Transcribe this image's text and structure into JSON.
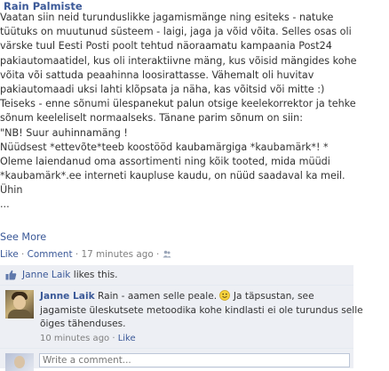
{
  "post": {
    "author": "Rain Palmiste",
    "lines": [
      "Vaatan siin neid turunduslikke jagamismänge ning esiteks - natuke",
      "tüütuks on muutunud süsteem - laigi, jaga ja võid võita. Selles osas oli",
      "värske tuul Eesti Posti poolt tehtud näoraamatu kampaania Post24",
      "pakiautomaatidel, kus oli interaktiivne mäng, kus võisid mängides kohe",
      "võita või sattuda peaahinna loosirattasse. Vähemalt oli huvitav",
      "pakiautomaadi uksi lahti klõpsata ja näha, kas võitsid või mitte :)",
      "Teiseks - enne sõnumi ülespanekut palun otsige keelekorrektor ja tehke",
      "sõnum keeleliselt normaalseks. Tänane parim sõnum on siin:",
      "\"NB! Suur auhinnamäng !",
      "Nüüdsest *ettevõte*teeb koostööd kaubamärgiga *kaubamärk*! *",
      "Oleme laiendanud oma assortimenti ning kõik tooted, mida müüdi",
      "*kaubamärk*.ee interneti kaupluse kaudu, on nüüd saadaval ka meil.",
      "Ühin",
      "..."
    ],
    "see_more": "See More",
    "meta": {
      "like": "Like",
      "separator": " · ",
      "comment": "Comment",
      "time": "17 minutes ago"
    }
  },
  "likes": {
    "name": "Janne Laik",
    "suffix": " likes this."
  },
  "comment": {
    "author": "Janne Laik",
    "lines": [
      " Rain - aamen selle peale. ",
      " Ja täpsustan, see",
      "jagamiste üleskutsete metoodika kohe kindlasti ei ole turundus selle",
      "õiges tähenduses."
    ],
    "time": "10 minutes ago",
    "separator": " · ",
    "like": "Like"
  },
  "reply": {
    "placeholder": "Write a comment..."
  },
  "colors": {
    "link": "#3b5998",
    "ufi_bg": "#edeff4",
    "meta_text": "#808080"
  },
  "icons": [
    "people-icon",
    "thumbs-up-icon",
    "smiley-icon"
  ]
}
